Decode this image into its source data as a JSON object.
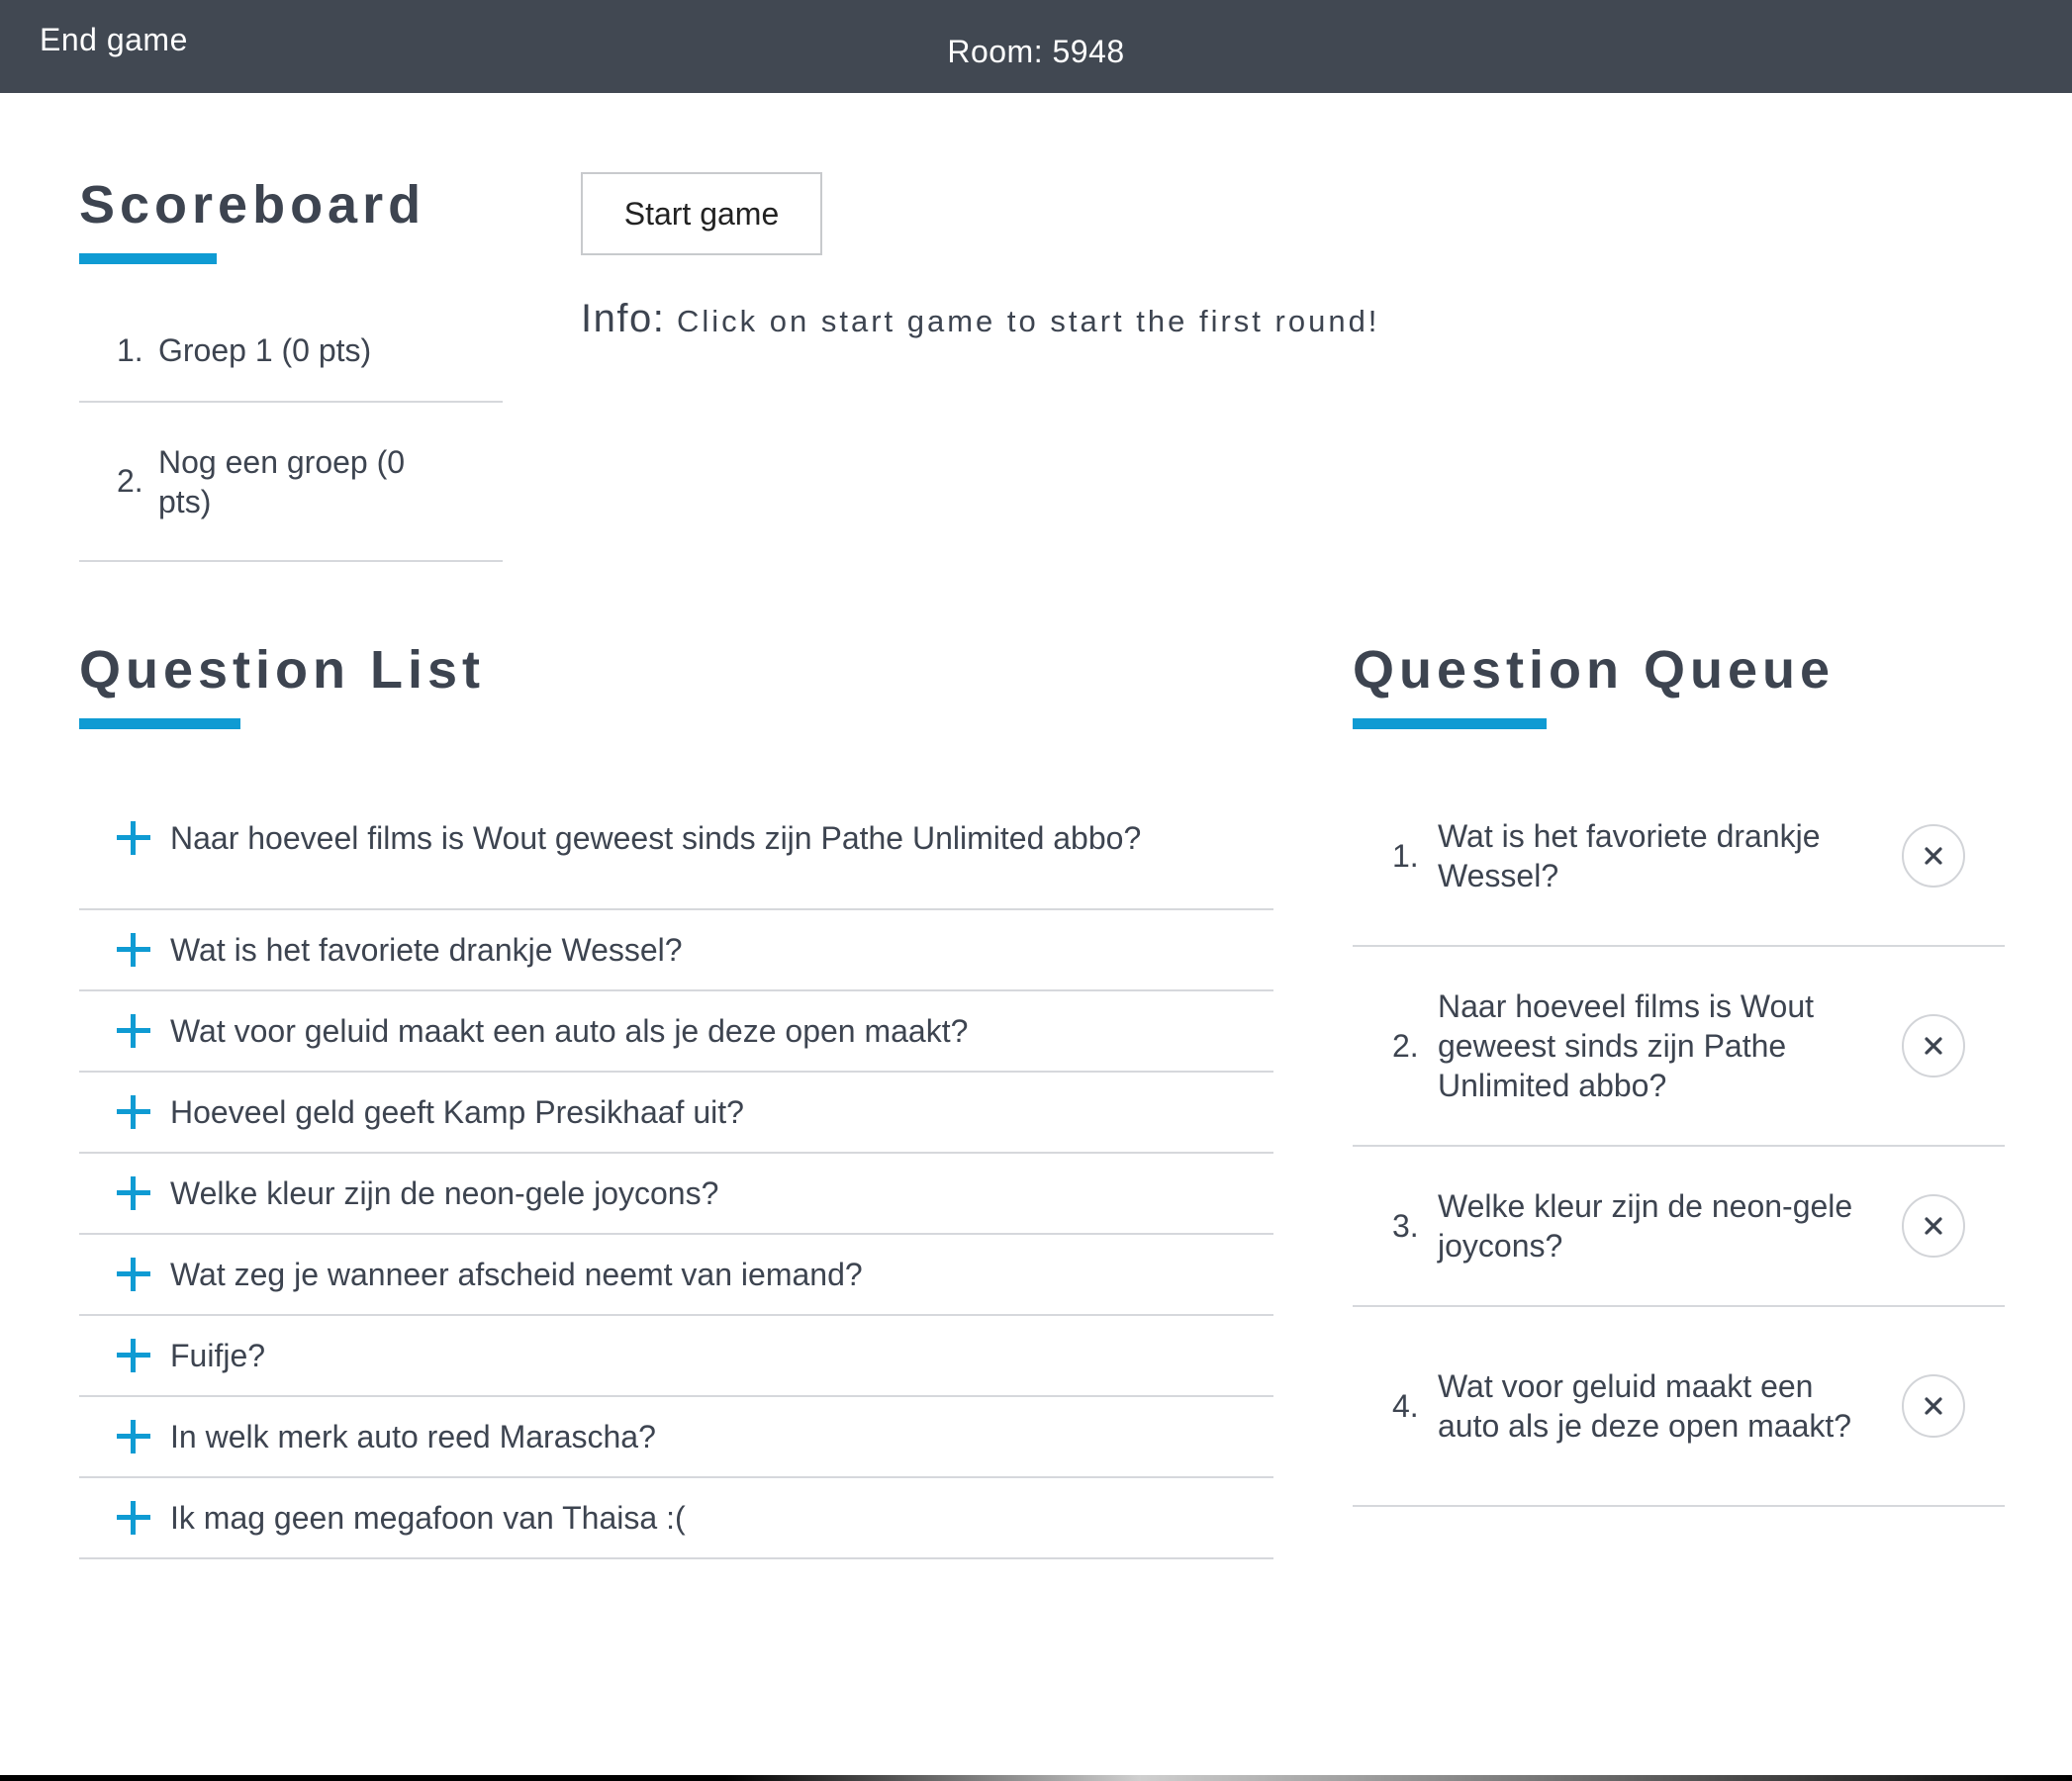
{
  "header": {
    "end_game_label": "End game",
    "room_label": "Room: 5948"
  },
  "scoreboard": {
    "title": "Scoreboard",
    "items": [
      {
        "num": "1.",
        "text": "Groep 1 (0 pts)"
      },
      {
        "num": "2.",
        "text": "Nog een groep (0 pts)"
      }
    ]
  },
  "controls": {
    "start_label": "Start game",
    "info_label": "Info:",
    "info_text": "Click on start game to start the first round!"
  },
  "question_list": {
    "title": "Question List",
    "items": [
      "Naar hoeveel films is Wout geweest sinds zijn Pathe Unlimited abbo?",
      "Wat is het favoriete drankje Wessel?",
      "Wat voor geluid maakt een auto als je deze open maakt?",
      "Hoeveel geld geeft Kamp Presikhaaf uit?",
      "Welke kleur zijn de neon-gele joycons?",
      "Wat zeg je wanneer afscheid neemt van iemand?",
      "Fuifje?",
      "In welk merk auto reed Marascha?",
      "Ik mag geen megafoon van Thaisa :("
    ]
  },
  "question_queue": {
    "title": "Question Queue",
    "items": [
      {
        "num": "1.",
        "text": "Wat is het favoriete drankje Wessel?"
      },
      {
        "num": "2.",
        "text": "Naar hoeveel films is Wout geweest sinds zijn Pathe Unlimited abbo?"
      },
      {
        "num": "3.",
        "text": "Welke kleur zijn de neon-gele joycons?"
      },
      {
        "num": "4.",
        "text": "Wat voor geluid maakt een auto als je deze open maakt?"
      }
    ]
  },
  "colors": {
    "header_bg": "#414852",
    "accent": "#0f9bd3",
    "text": "#3d4450",
    "divider": "#d6d8dc"
  },
  "icons": {
    "add": "plus-icon",
    "remove": "close-icon"
  }
}
